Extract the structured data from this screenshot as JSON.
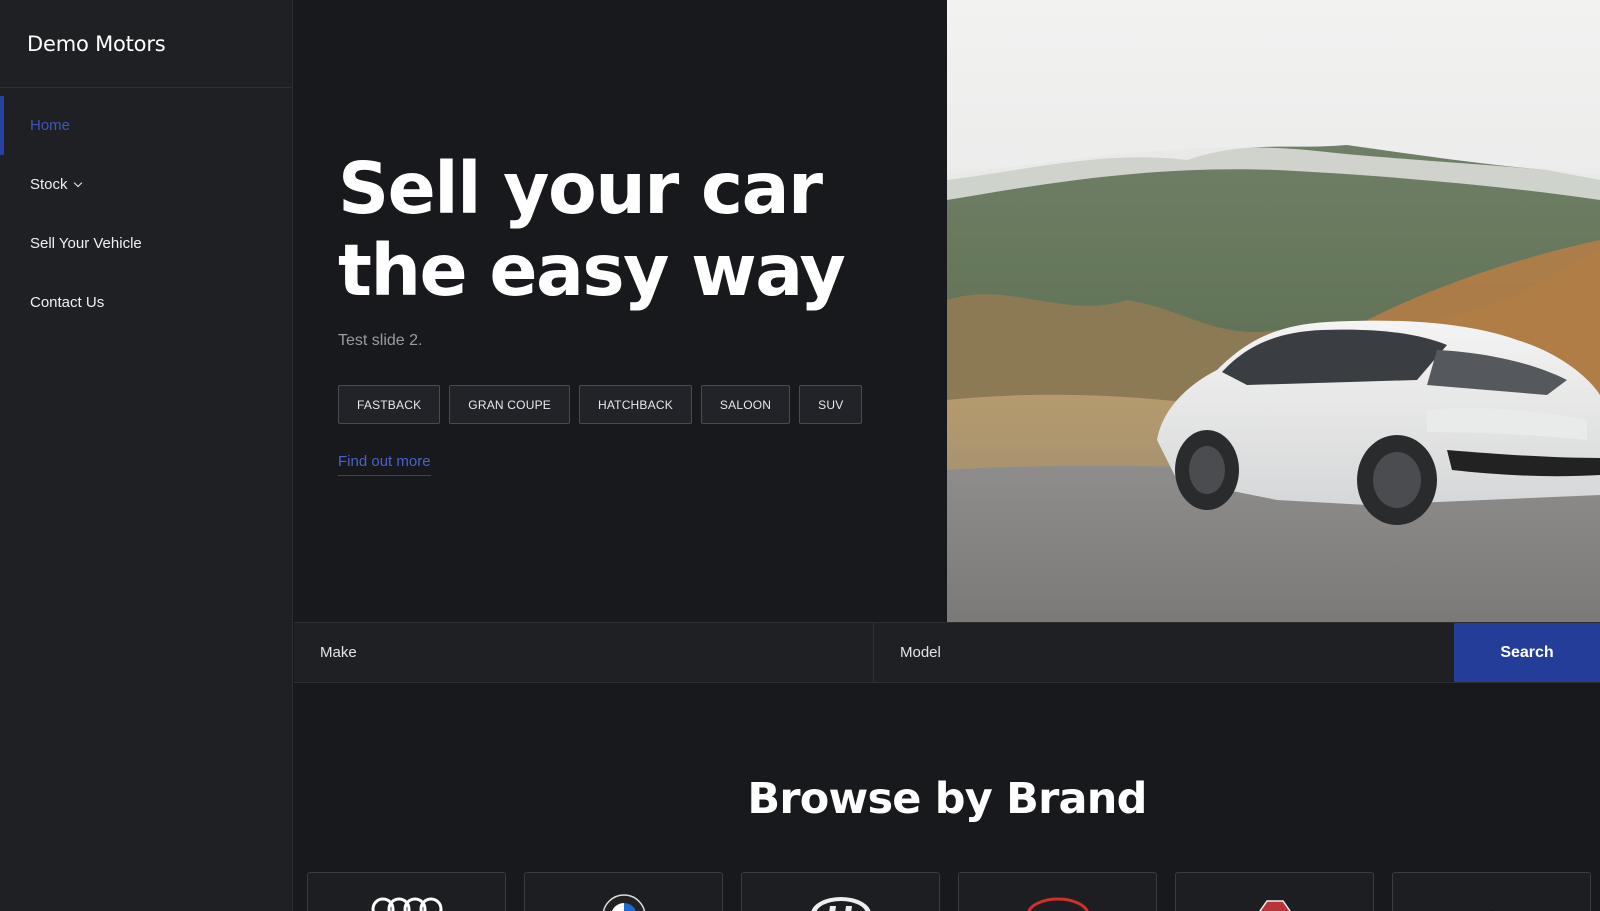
{
  "sidebar": {
    "brand": "Demo Motors",
    "items": [
      {
        "label": "Home",
        "active": true
      },
      {
        "label": "Stock",
        "has_dropdown": true
      },
      {
        "label": "Sell Your Vehicle"
      },
      {
        "label": "Contact Us"
      }
    ]
  },
  "hero": {
    "title_line1": "Sell your car",
    "title_line2": "the easy way",
    "subtitle": "Test slide 2.",
    "tags": [
      "FASTBACK",
      "GRAN COUPE",
      "HATCHBACK",
      "SALOON",
      "SUV"
    ],
    "link": "Find out more"
  },
  "search": {
    "make_label": "Make",
    "model_label": "Model",
    "button": "Search"
  },
  "brands": {
    "title": "Browse by Brand",
    "logos": [
      "audi-logo",
      "bmw-logo",
      "hyundai-logo",
      "toyota-logo",
      "mg-logo",
      "brand-logo"
    ]
  },
  "colors": {
    "accent": "#233d98",
    "active_nav": "#3b56b8",
    "background": "#18191d",
    "panel": "#1f2024"
  }
}
